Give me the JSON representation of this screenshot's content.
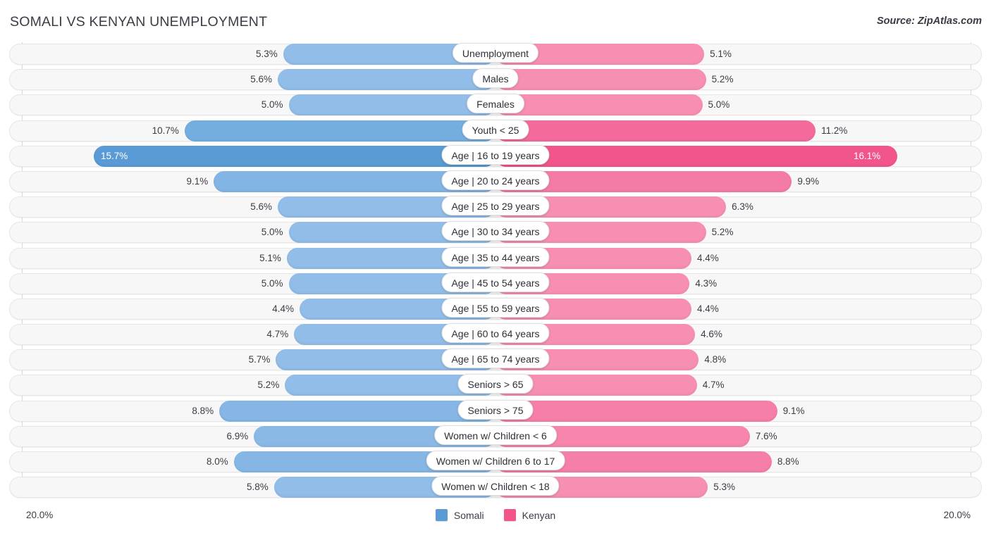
{
  "header": {
    "title": "SOMALI VS KENYAN UNEMPLOYMENT",
    "source": "Source: ZipAtlas.com"
  },
  "axis": {
    "left_label": "20.0%",
    "right_label": "20.0%",
    "max": 20.0
  },
  "legend": {
    "items": [
      {
        "label": "Somali",
        "color": "#5b9bd5"
      },
      {
        "label": "Kenyan",
        "color": "#f2558c"
      }
    ]
  },
  "colors": {
    "somali": "#91bde8",
    "kenyan": "#f78fb3",
    "somali_highlight": "#5b9bd5",
    "kenyan_highlight": "#f2558c",
    "track": "#f7f7f7",
    "text": "#3c3c46"
  },
  "chart_data": {
    "type": "bar",
    "subtype": "diverging-bidirectional",
    "title": "SOMALI VS KENYAN UNEMPLOYMENT",
    "xlabel": "",
    "ylabel": "",
    "xlim": [
      20.0,
      20.0
    ],
    "unit": "%",
    "grid": true,
    "legend_position": "bottom-center",
    "categories": [
      "Unemployment",
      "Males",
      "Females",
      "Youth < 25",
      "Age | 16 to 19 years",
      "Age | 20 to 24 years",
      "Age | 25 to 29 years",
      "Age | 30 to 34 years",
      "Age | 35 to 44 years",
      "Age | 45 to 54 years",
      "Age | 55 to 59 years",
      "Age | 60 to 64 years",
      "Age | 65 to 74 years",
      "Seniors > 65",
      "Seniors > 75",
      "Women w/ Children < 6",
      "Women w/ Children 6 to 17",
      "Women w/ Children < 18"
    ],
    "series": [
      {
        "name": "Somali",
        "color": "#91bde8",
        "values": [
          5.3,
          5.6,
          5.0,
          10.7,
          15.7,
          9.1,
          5.6,
          5.0,
          5.1,
          5.0,
          4.4,
          4.7,
          5.7,
          5.2,
          8.8,
          6.9,
          8.0,
          5.8
        ]
      },
      {
        "name": "Kenyan",
        "color": "#f78fb3",
        "values": [
          5.1,
          5.2,
          5.0,
          11.2,
          16.1,
          9.9,
          6.3,
          5.2,
          4.4,
          4.3,
          4.4,
          4.6,
          4.8,
          4.7,
          9.1,
          7.6,
          8.8,
          5.3
        ]
      }
    ]
  },
  "rows": [
    {
      "label": "Unemployment",
      "left": "5.3%",
      "right": "5.1%",
      "lv": 5.3,
      "rv": 5.1
    },
    {
      "label": "Males",
      "left": "5.6%",
      "right": "5.2%",
      "lv": 5.6,
      "rv": 5.2
    },
    {
      "label": "Females",
      "left": "5.0%",
      "right": "5.0%",
      "lv": 5.0,
      "rv": 5.0
    },
    {
      "label": "Youth < 25",
      "left": "10.7%",
      "right": "11.2%",
      "lv": 10.7,
      "rv": 11.2
    },
    {
      "label": "Age | 16 to 19 years",
      "left": "15.7%",
      "right": "16.1%",
      "lv": 15.7,
      "rv": 16.1
    },
    {
      "label": "Age | 20 to 24 years",
      "left": "9.1%",
      "right": "9.9%",
      "lv": 9.1,
      "rv": 9.9
    },
    {
      "label": "Age | 25 to 29 years",
      "left": "5.6%",
      "right": "6.3%",
      "lv": 5.6,
      "rv": 6.3
    },
    {
      "label": "Age | 30 to 34 years",
      "left": "5.0%",
      "right": "5.2%",
      "lv": 5.0,
      "rv": 5.2
    },
    {
      "label": "Age | 35 to 44 years",
      "left": "5.1%",
      "right": "4.4%",
      "lv": 5.1,
      "rv": 4.4
    },
    {
      "label": "Age | 45 to 54 years",
      "left": "5.0%",
      "right": "4.3%",
      "lv": 5.0,
      "rv": 4.3
    },
    {
      "label": "Age | 55 to 59 years",
      "left": "4.4%",
      "right": "4.4%",
      "lv": 4.4,
      "rv": 4.4
    },
    {
      "label": "Age | 60 to 64 years",
      "left": "4.7%",
      "right": "4.6%",
      "lv": 4.7,
      "rv": 4.6
    },
    {
      "label": "Age | 65 to 74 years",
      "left": "5.7%",
      "right": "4.8%",
      "lv": 5.7,
      "rv": 4.8
    },
    {
      "label": "Seniors > 65",
      "left": "5.2%",
      "right": "4.7%",
      "lv": 5.2,
      "rv": 4.7
    },
    {
      "label": "Seniors > 75",
      "left": "8.8%",
      "right": "9.1%",
      "lv": 8.8,
      "rv": 9.1
    },
    {
      "label": "Women w/ Children < 6",
      "left": "6.9%",
      "right": "7.6%",
      "lv": 6.9,
      "rv": 7.6
    },
    {
      "label": "Women w/ Children 6 to 17",
      "left": "8.0%",
      "right": "8.8%",
      "lv": 8.0,
      "rv": 8.8
    },
    {
      "label": "Women w/ Children < 18",
      "left": "5.8%",
      "right": "5.3%",
      "lv": 5.8,
      "rv": 5.3
    }
  ]
}
